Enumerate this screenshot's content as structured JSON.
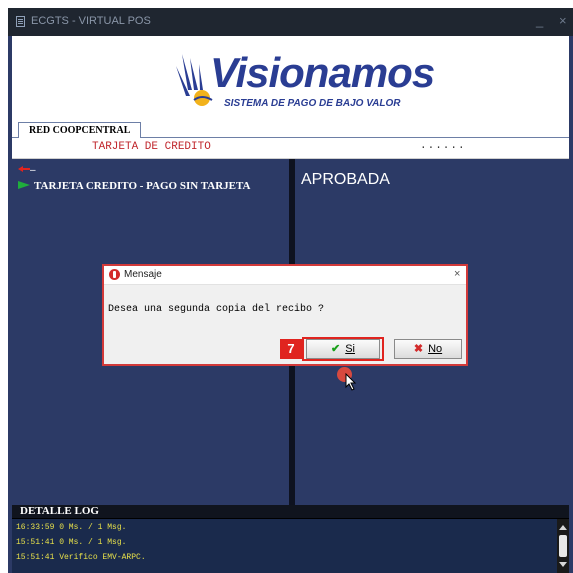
{
  "window": {
    "title": "ECGTS - VIRTUAL POS",
    "minimize": "_",
    "close": "×"
  },
  "banner": {
    "logo_text": "Visionamos",
    "logo_subtitle": "SISTEMA DE PAGO DE BAJO VALOR"
  },
  "tabs": [
    {
      "label": "RED COOPCENTRAL",
      "active": true
    }
  ],
  "status": {
    "label": "TARJETA DE CREDITO",
    "dots": "......"
  },
  "left_pane": {
    "row1_text": "–",
    "row2_text": "TARJETA CREDITO - PAGO SIN TARJETA"
  },
  "right_pane": {
    "result": "APROBADA"
  },
  "dialog": {
    "title": "Mensaje",
    "close": "×",
    "message": "Desea una segunda copia del recibo ?",
    "step_badge": "7",
    "yes_label": "Si",
    "no_label": "No"
  },
  "log": {
    "header": "DETALLE LOG",
    "lines": [
      "16:33:59 0 Ms. / 1 Msg.",
      "15:51:41 0 Ms. / 1 Msg.",
      "15:51:41 Verifico EMV-ARPC."
    ]
  },
  "colors": {
    "panel_bg": "#2c3a66",
    "log_text": "#e7e04a",
    "status_label": "#c0272d",
    "highlight": "#e0241f",
    "logo_blue": "#2a3d93"
  }
}
